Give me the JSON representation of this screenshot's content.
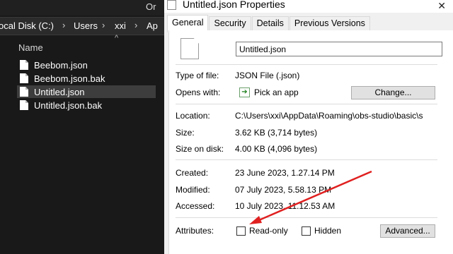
{
  "explorer": {
    "top_fragment": "Or",
    "breadcrumb": [
      "ocal Disk (C:)",
      "Users",
      "xxi",
      "Ap"
    ],
    "column_header": "Name",
    "files": [
      {
        "name": "Beebom.json"
      },
      {
        "name": "Beebom.json.bak"
      },
      {
        "name": "Untitled.json",
        "selected": true
      },
      {
        "name": "Untitled.json.bak"
      }
    ]
  },
  "dialog": {
    "title": "Untitled.json Properties",
    "close_glyph": "✕",
    "tabs": [
      {
        "label": "General",
        "active": true
      },
      {
        "label": "Security"
      },
      {
        "label": "Details"
      },
      {
        "label": "Previous Versions"
      }
    ],
    "file_name_value": "Untitled.json",
    "type_label": "Type of file:",
    "type_value": "JSON File (.json)",
    "opens_label": "Opens with:",
    "opens_value": "Pick an app",
    "change_button": "Change...",
    "location_label": "Location:",
    "location_value": "C:\\Users\\xxi\\AppData\\Roaming\\obs-studio\\basic\\s",
    "size_label": "Size:",
    "size_value": "3.62 KB (3,714 bytes)",
    "size_on_disk_label": "Size on disk:",
    "size_on_disk_value": "4.00 KB (4,096 bytes)",
    "created_label": "Created:",
    "created_value": "23 June 2023, 1.27.14 PM",
    "modified_label": "Modified:",
    "modified_value": "07 July 2023, 5.58.13 PM",
    "accessed_label": "Accessed:",
    "accessed_value": "10 July 2023, 11.12.53 AM",
    "attributes_label": "Attributes:",
    "readonly_label": "Read-only",
    "readonly_checked": false,
    "hidden_label": "Hidden",
    "hidden_checked": false,
    "advanced_button": "Advanced...",
    "annotation_arrow_color": "#e02020"
  }
}
